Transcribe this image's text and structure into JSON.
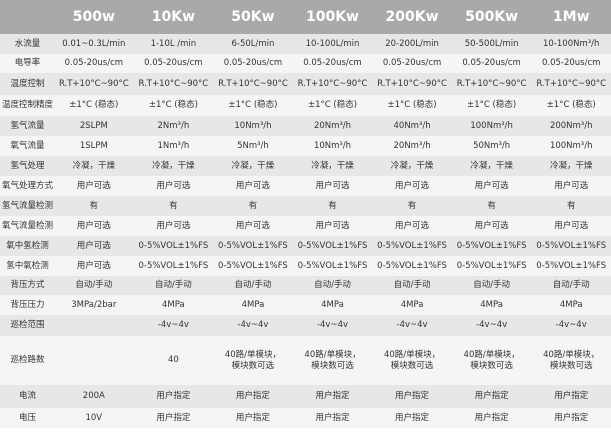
{
  "header": {
    "corner": "",
    "models": [
      "500w",
      "10Kw",
      "50Kw",
      "100Kw",
      "200Kw",
      "500Kw",
      "1Mw"
    ]
  },
  "rows": [
    {
      "label": "水流量",
      "values": [
        "0.01~0.3L/min",
        "1-10L /min",
        "6-50L/min",
        "10-100L/min",
        "20-200L/min",
        "50-500L/min",
        "10-100Nm³/h"
      ]
    },
    {
      "label": "电导率",
      "values": [
        "0.05-20us/cm",
        "0.05-20us/cm",
        "0.05-20us/cm",
        "0.05-20us/cm",
        "0.05-20us/cm",
        "0.05-20us/cm",
        "0.05-20us/cm"
      ]
    },
    {
      "label": "温度控制",
      "values": [
        "R.T+10°C~90°C",
        "R.T+10°C~90°C",
        "R.T+10°C~90°C",
        "R.T+10°C~90°C",
        "R.T+10°C~90°C",
        "R.T+10°C~90°C",
        "R.T+10°C~90°C"
      ]
    },
    {
      "label": "温度控制精度",
      "values": [
        "±1°C (稳态)",
        "±1°C (稳态)",
        "±1°C (稳态)",
        "±1°C (稳态)",
        "±1°C (稳态)",
        "±1°C (稳态)",
        "±1°C (稳态)"
      ]
    },
    {
      "label": "氢气流量",
      "values": [
        "2SLPM",
        "2Nm³/h",
        "10Nm³/h",
        "20Nm³/h",
        "40Nm³/h",
        "100Nm³/h",
        "200Nm³/h"
      ]
    },
    {
      "label": "氧气流量",
      "values": [
        "1SLPM",
        "1Nm³/h",
        "5Nm³/h",
        "10Nm³/h",
        "20Nm³/h",
        "50Nm³/h",
        "100Nm³/h"
      ]
    },
    {
      "label": "氢气处理",
      "values": [
        "冷凝，干燥",
        "冷凝，干燥",
        "冷凝，干燥",
        "冷凝，干燥",
        "冷凝，干燥",
        "冷凝，干燥",
        "冷凝，干燥"
      ]
    },
    {
      "label": "氧气处理方式",
      "values": [
        "用户可选",
        "用户可选",
        "用户可选",
        "用户可选",
        "用户可选",
        "用户可选",
        "用户可选"
      ]
    },
    {
      "label": "氢气流量检测",
      "values": [
        "有",
        "有",
        "有",
        "有",
        "有",
        "有",
        "有"
      ]
    },
    {
      "label": "氧气流量检测",
      "values": [
        "用户可选",
        "用户可选",
        "用户可选",
        "用户可选",
        "用户可选",
        "用户可选",
        "用户可选"
      ]
    },
    {
      "label": "氧中氢检测",
      "values": [
        "用户可选",
        "0-5%VOL±1%FS",
        "0-5%VOL±1%FS",
        "0-5%VOL±1%FS",
        "0-5%VOL±1%FS",
        "0-5%VOL±1%FS",
        "0-5%VOL±1%FS"
      ]
    },
    {
      "label": "氢中氧检测",
      "values": [
        "用户可选",
        "0-5%VOL±1%FS",
        "0-5%VOL±1%FS",
        "0-5%VOL±1%FS",
        "0-5%VOL±1%FS",
        "0-5%VOL±1%FS",
        "0-5%VOL±1%FS"
      ]
    },
    {
      "label": "背压方式",
      "values": [
        "自动/手动",
        "自动/手动",
        "自动/手动",
        "自动/手动",
        "自动/手动",
        "自动/手动",
        "自动/手动"
      ]
    },
    {
      "label": "背压压力",
      "values": [
        "3MPa/2bar",
        "4MPa",
        "4MPa",
        "4MPa",
        "4MPa",
        "4MPa",
        "4MPa"
      ]
    },
    {
      "label": "巡检范围",
      "values": [
        "",
        "-4v~4v",
        "-4v~4v",
        "-4v~4v",
        "-4v~4v",
        "-4v~4v",
        "-4v~4v"
      ]
    },
    {
      "label": "巡检路数",
      "values": [
        "",
        "40",
        "40路/单模块，\n模块数可选",
        "40路/单模块，\n模块数可选",
        "40路/单模块，\n模块数可选",
        "40路/单模块，\n模块数可选",
        "40路/单模块，\n模块数可选"
      ],
      "tall": true
    },
    {
      "label": "电流",
      "values": [
        "200A",
        "用户指定",
        "用户指定",
        "用户指定",
        "用户指定",
        "用户指定",
        "用户指定"
      ]
    },
    {
      "label": "电压",
      "values": [
        "10V",
        "用户指定",
        "用户指定",
        "用户指定",
        "用户指定",
        "用户指定",
        "用户指定"
      ]
    }
  ]
}
